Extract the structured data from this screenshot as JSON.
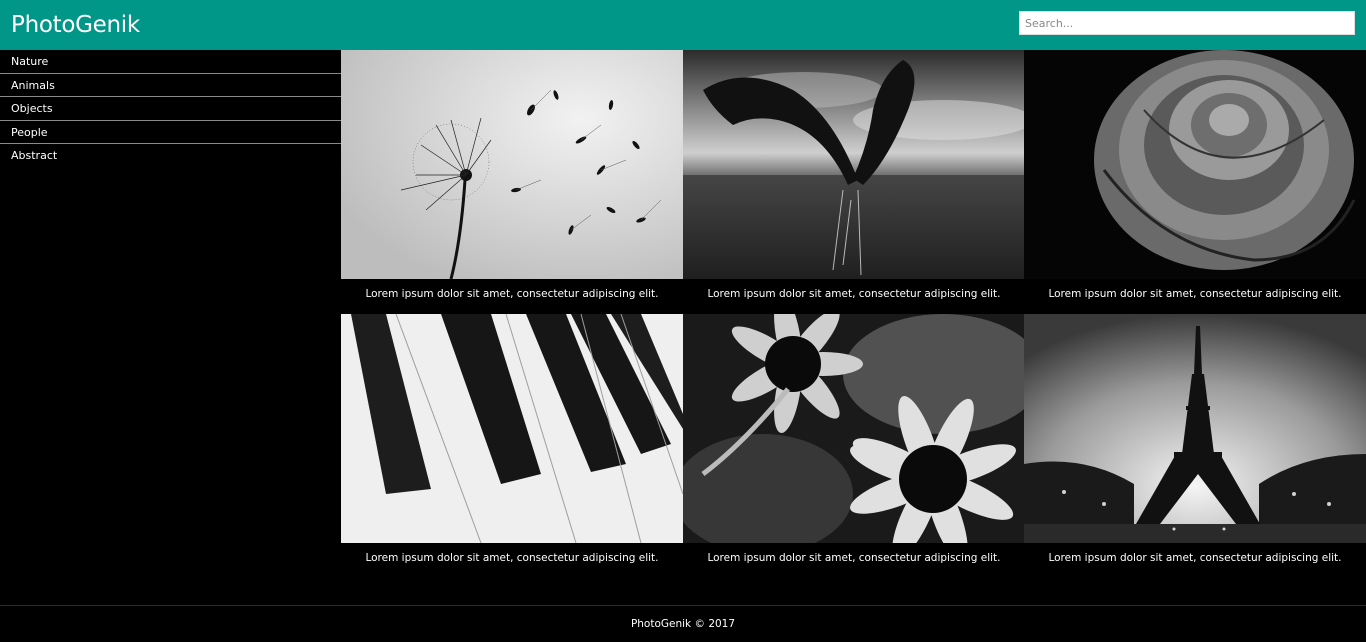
{
  "header": {
    "brand": "PhotoGenik",
    "search_placeholder": "Search..."
  },
  "sidebar": {
    "items": [
      {
        "label": "Nature"
      },
      {
        "label": "Animals"
      },
      {
        "label": "Objects"
      },
      {
        "label": "People"
      },
      {
        "label": "Abstract"
      }
    ]
  },
  "gallery": {
    "items": [
      {
        "caption": "Lorem ipsum dolor sit amet, consectetur adipiscing elit."
      },
      {
        "caption": "Lorem ipsum dolor sit amet, consectetur adipiscing elit."
      },
      {
        "caption": "Lorem ipsum dolor sit amet, consectetur adipiscing elit."
      },
      {
        "caption": "Lorem ipsum dolor sit amet, consectetur adipiscing elit."
      },
      {
        "caption": "Lorem ipsum dolor sit amet, consectetur adipiscing elit."
      },
      {
        "caption": "Lorem ipsum dolor sit amet, consectetur adipiscing elit."
      }
    ]
  },
  "footer": {
    "text": "PhotoGenik © 2017"
  },
  "colors": {
    "header": "#009688",
    "background": "#000000",
    "text": "#ffffff"
  }
}
